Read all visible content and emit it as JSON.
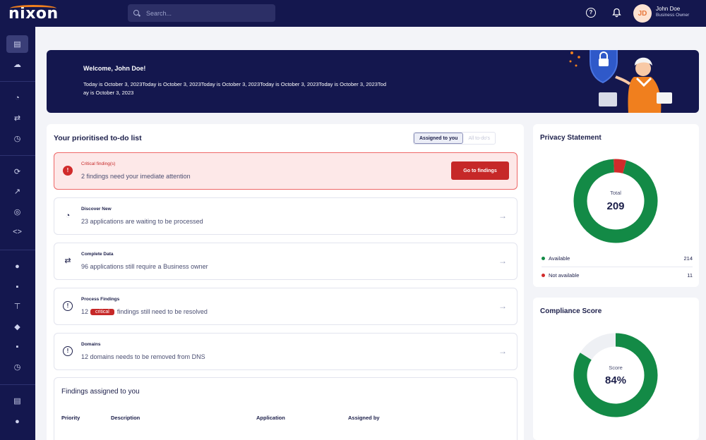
{
  "app": {
    "logo_text": "nixon"
  },
  "search": {
    "placeholder": "Search..."
  },
  "user": {
    "initials": "JD",
    "name": "John Doe",
    "role": "Business Owner"
  },
  "banner": {
    "welcome": "Welcome, John Doe!",
    "date_text": "Today is October 3, 2023Today is October 3, 2023Today is October 3, 2023Today is October 3, 2023Today is October 3, 2023Today is October 3, 2023"
  },
  "todo": {
    "title": "Your prioritised to-do list",
    "toggle": {
      "assigned": "Assigned to you",
      "all": "All to-do's"
    },
    "critical": {
      "title": "Critical finding(s)",
      "description": "2 findings need your imediate attention",
      "button": "Go to findings"
    },
    "tasks": [
      {
        "title": "Discover New",
        "description": "23 applications are waiting to be processed",
        "icon": "pie-chart-icon"
      },
      {
        "title": "Complete Data",
        "description": "96 applications still require a Business owner",
        "icon": "filter-icon"
      },
      {
        "title": "Process Findings",
        "count": "12",
        "badge": "critical",
        "description": "findings still need to be resolved",
        "icon": "alert-circle-icon"
      },
      {
        "title": "Domains",
        "description": "12 domains needs to be removed from DNS",
        "icon": "alert-circle-icon"
      }
    ]
  },
  "findings": {
    "title": "Findings assigned to you",
    "columns": [
      "Priority",
      "Description",
      "Application",
      "Assigned by"
    ]
  },
  "privacy": {
    "title": "Privacy Statement",
    "center_label": "Total",
    "total": "209",
    "legend": [
      {
        "label": "Available",
        "value": "214",
        "color": "#138a46"
      },
      {
        "label": "Not available",
        "value": "11",
        "color": "#d12b2b"
      }
    ],
    "chart_data": {
      "type": "pie",
      "categories": [
        "Available",
        "Not available"
      ],
      "values": [
        214,
        11
      ]
    }
  },
  "compliance": {
    "title": "Compliance Score",
    "center_label": "Score",
    "value": "84%",
    "chart_data": {
      "type": "pie",
      "categories": [
        "Score",
        "Remaining"
      ],
      "values": [
        84,
        16
      ]
    }
  },
  "colors": {
    "navy": "#14174e",
    "accent_orange": "#f07f1e",
    "critical_red": "#c62828",
    "success_green": "#138a46"
  },
  "sidebar_icons": [
    "dashboard-icon",
    "cloud-icon",
    "chart-icon",
    "shuffle-icon",
    "clock-icon",
    "refresh-icon",
    "trend-icon",
    "eye-icon",
    "code-icon",
    "user-icon",
    "folder-icon",
    "network-icon",
    "tag-icon",
    "folder-icon",
    "alert-icon",
    "list-icon",
    "users-icon"
  ]
}
